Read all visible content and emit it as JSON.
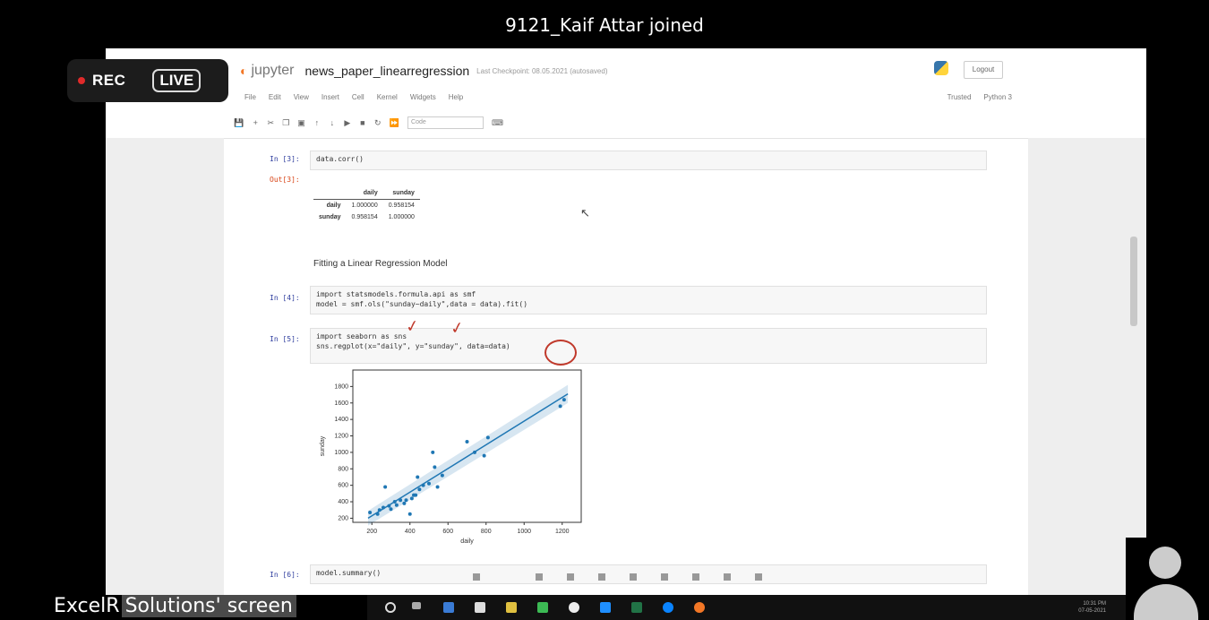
{
  "notification": "9121_Kaif Attar joined",
  "recording": {
    "rec_label": "REC",
    "live_label": "LIVE"
  },
  "screen_share_label": {
    "part1": "ExcelR",
    "part2": "Solutions' screen"
  },
  "jupyter": {
    "app_name": "jupyter",
    "notebook_name": "news_paper_linearregression",
    "checkpoint_text": "Last Checkpoint: 08.05.2021 (autosaved)",
    "logout_label": "Logout",
    "menu": [
      "File",
      "Edit",
      "View",
      "Insert",
      "Cell",
      "Kernel",
      "Widgets",
      "Help"
    ],
    "trusted_label": "Trusted",
    "kernel_label": "Python 3",
    "cell_type_select": "Code"
  },
  "cells": [
    {
      "prompt": "In [3]:",
      "code": "data.corr()"
    },
    {
      "prompt_out": "Out[3]:"
    },
    {
      "markdown": "Fitting a Linear Regression Model"
    },
    {
      "prompt": "In [4]:",
      "code_lines": [
        "import statsmodels.formula.api as smf",
        "model = smf.ols(\"sunday~daily\",data = data).fit()"
      ]
    },
    {
      "prompt": "In [5]:",
      "code_lines": [
        "import seaborn as sns",
        "sns.regplot(x=\"daily\", y=\"sunday\", data=data)"
      ]
    },
    {
      "prompt": "In [6]:",
      "code": "model.summary()"
    }
  ],
  "corr_table": {
    "columns": [
      "daily",
      "sunday"
    ],
    "rows": [
      {
        "name": "daily",
        "values": [
          "1.000000",
          "0.958154"
        ]
      },
      {
        "name": "sunday",
        "values": [
          "0.958154",
          "1.000000"
        ]
      }
    ]
  },
  "chart_data": {
    "type": "scatter",
    "xlabel": "daily",
    "ylabel": "sunday",
    "xlim": [
      100,
      1300
    ],
    "ylim": [
      150,
      2000
    ],
    "xticks": [
      200,
      400,
      600,
      800,
      1000,
      1200
    ],
    "yticks": [
      200,
      400,
      600,
      800,
      1000,
      1200,
      1400,
      1600,
      1800
    ],
    "points": [
      [
        190,
        270
      ],
      [
        230,
        250
      ],
      [
        240,
        300
      ],
      [
        260,
        330
      ],
      [
        270,
        580
      ],
      [
        290,
        350
      ],
      [
        300,
        310
      ],
      [
        320,
        400
      ],
      [
        330,
        360
      ],
      [
        350,
        420
      ],
      [
        370,
        380
      ],
      [
        380,
        420
      ],
      [
        400,
        250
      ],
      [
        410,
        440
      ],
      [
        420,
        480
      ],
      [
        430,
        480
      ],
      [
        440,
        700
      ],
      [
        450,
        550
      ],
      [
        470,
        600
      ],
      [
        500,
        620
      ],
      [
        520,
        1000
      ],
      [
        530,
        820
      ],
      [
        545,
        580
      ],
      [
        570,
        720
      ],
      [
        700,
        1130
      ],
      [
        740,
        1000
      ],
      [
        790,
        960
      ],
      [
        810,
        1180
      ],
      [
        1190,
        1560
      ],
      [
        1210,
        1640
      ]
    ],
    "fit_line": [
      [
        180,
        200
      ],
      [
        1230,
        1710
      ]
    ],
    "grid": false,
    "color": "#1f77b4"
  },
  "taskbar": {
    "time": "10:31 PM",
    "date": "07-05-2021"
  }
}
